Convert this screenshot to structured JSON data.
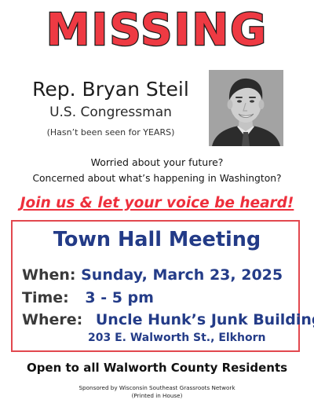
{
  "headline": "MISSING",
  "person": {
    "name": "Rep. Bryan Steil",
    "title": "U.S. Congressman",
    "note": "(Hasn’t been seen for YEARS)"
  },
  "concerns": [
    "Worried about your future?",
    "Concerned about what’s happening in Washington?"
  ],
  "call_to_action": "Join us & let your voice be heard!",
  "event": {
    "title": "Town Hall Meeting",
    "when_label": "When:",
    "when_value": "Sunday, March 23, 2025",
    "time_label": "Time:",
    "time_value": "3 - 5 pm",
    "where_label": "Where:",
    "where_value": "Uncle Hunk’s Junk Building",
    "address": "203 E. Walworth St., Elkhorn"
  },
  "audience": "Open to all Walworth County Residents",
  "sponsor": "Sponsored by Wisconsin Southeast Grassroots Network",
  "printed": "(Printed in House)",
  "colors": {
    "headline_red": "#ee3a43",
    "cta_red": "#ee2f3c",
    "box_border": "#e2484f",
    "navy": "#243c88",
    "label_gray": "#3a3a3a"
  }
}
